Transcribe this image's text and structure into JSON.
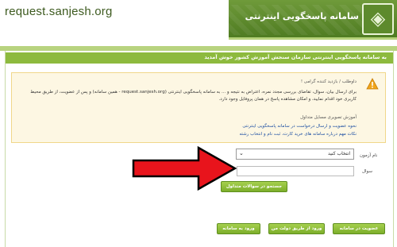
{
  "header": {
    "site_url": "request.sanjesh.org",
    "banner_title": "سامانه پاسخگویی اینترنتی"
  },
  "titlebar": {
    "text": "به سامانه پاسخگویی اینترنتی سازمان سنجش آموزش کشور خوش آمدید"
  },
  "notice": {
    "greeting": "داوطلب / بازدید کننده گرامی !",
    "paragraph": "برای ارسال بیان، سوال، تقاضای بررسی مجدد نمره، اعتراض به نتیجه و ... به سامانه پاسخگویی اینترنتی (request.sanjesh.org - همین سامانه) و پس از عضویت، از طریق محیط کاربری خود اقدام نمایید، و امکان مشاهده پاسخ در همان پروفایل وجود دارد.",
    "tips_title": "آموزش تصویری مسایل متداول",
    "links": [
      "نحوه عضویت و ارسال درخواست در سامانه پاسخگویی اینترنتی",
      "نکات مهم درباره سامانه های خرید کارت، ثبت نام و انتخاب رشته"
    ]
  },
  "form": {
    "category_label": "نام آزمون",
    "category_selected": "انتخاب کنید",
    "question_label": "سوال",
    "question_value": "",
    "search_button": "جستجو در سوالات متداول"
  },
  "actions": {
    "enter_button": "ورود به سامانه",
    "gov_button": "ورود از طریق دولت من",
    "register_button": "عضویت در سامانه"
  },
  "colors": {
    "accent_green": "#8dba3e",
    "arrow_red": "#e8141c",
    "link_blue": "#1d4fa3"
  }
}
